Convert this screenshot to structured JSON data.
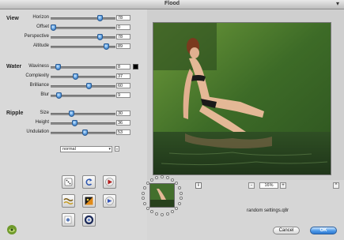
{
  "window": {
    "title": "Flood"
  },
  "sections": {
    "view": "View",
    "water": "Water",
    "ripple": "Ripple"
  },
  "view_params": [
    {
      "label": "Horizon",
      "value": "78",
      "fraction": 0.78
    },
    {
      "label": "Offset",
      "value": "0",
      "fraction": 0.0
    },
    {
      "label": "Perspective",
      "value": "78",
      "fraction": 0.78
    },
    {
      "label": "Altitude",
      "value": "89",
      "fraction": 0.89
    }
  ],
  "water_params": [
    {
      "label": "Waviness",
      "value": "8",
      "fraction": 0.08
    },
    {
      "label": "Complexity",
      "value": "37",
      "fraction": 0.37
    },
    {
      "label": "Brilliance",
      "value": "60",
      "fraction": 0.6
    },
    {
      "label": "Blur",
      "value": "9",
      "fraction": 0.09
    }
  ],
  "ripple_params": [
    {
      "label": "Size",
      "value": "30",
      "fraction": 0.3
    },
    {
      "label": "Height",
      "value": "36",
      "fraction": 0.36
    },
    {
      "label": "Undulation",
      "value": "53",
      "fraction": 0.53
    }
  ],
  "glue": {
    "label": "Glue",
    "selected": "normal"
  },
  "glue_button": "»",
  "zoom": {
    "value": "16%",
    "minus": "-",
    "plus": "+"
  },
  "settings_file": "random settings.q8r",
  "buttons": {
    "cancel": "Cancel",
    "ok": "OK"
  },
  "info": "i",
  "collapse": "^",
  "colors": {
    "accent": "#4d99e8",
    "water_color": "#000000",
    "grass": "#3f6a2b"
  },
  "tool_icons": [
    "dice-icon",
    "undo-icon",
    "play-icon",
    "wave-icon",
    "gradient-icon",
    "target-icon",
    "sample-icon",
    "ring-icon"
  ]
}
